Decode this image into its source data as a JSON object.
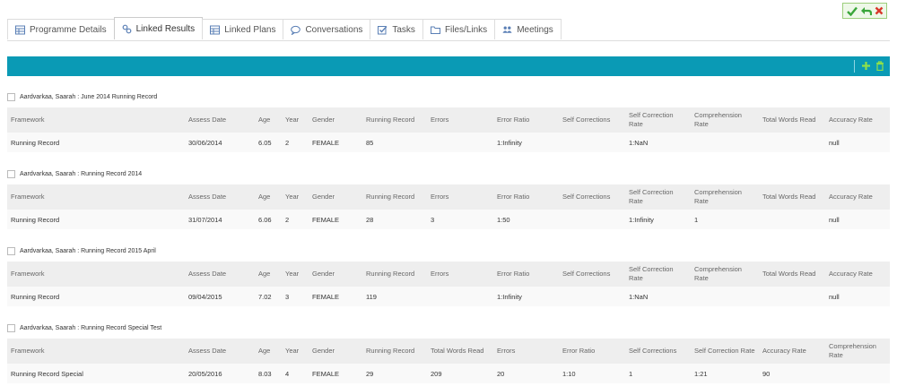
{
  "tabs": [
    {
      "label": "Programme Details",
      "icon": "table-icon",
      "active": false
    },
    {
      "label": "Linked Results",
      "icon": "link-icon",
      "active": true
    },
    {
      "label": "Linked Plans",
      "icon": "table-icon",
      "active": false
    },
    {
      "label": "Conversations",
      "icon": "chat-bubble-icon",
      "active": false
    },
    {
      "label": "Tasks",
      "icon": "checkbox-icon",
      "active": false
    },
    {
      "label": "Files/Links",
      "icon": "folder-icon",
      "active": false
    },
    {
      "label": "Meetings",
      "icon": "users-icon",
      "active": false
    }
  ],
  "actions": {
    "save": "check-icon",
    "undo": "undo-icon",
    "close": "close-icon"
  },
  "toolbar": {
    "add": "plus-icon",
    "delete": "trash-icon"
  },
  "colors": {
    "accent": "#0a9ab5",
    "save": "#3aa63a",
    "close": "#d9372b"
  },
  "records": [
    {
      "title": "Aardvarkaa, Saarah : June 2014 Running Record",
      "columns": [
        "Framework",
        "Assess Date",
        "Age",
        "Year",
        "Gender",
        "Running Record",
        "Errors",
        "Error Ratio",
        "Self Corrections",
        "Self Correction Rate",
        "Comprehension Rate",
        "Total Words Read",
        "Accuracy Rate"
      ],
      "rows": [
        [
          "Running Record",
          "30/06/2014",
          "6.05",
          "2",
          "FEMALE",
          "85",
          "",
          "1:Infinity",
          "",
          "1:NaN",
          "",
          "",
          "null"
        ]
      ]
    },
    {
      "title": "Aardvarkaa, Saarah : Running Record 2014",
      "columns": [
        "Framework",
        "Assess Date",
        "Age",
        "Year",
        "Gender",
        "Running Record",
        "Errors",
        "Error Ratio",
        "Self Corrections",
        "Self Correction Rate",
        "Comprehension Rate",
        "Total Words Read",
        "Accuracy Rate"
      ],
      "rows": [
        [
          "Running Record",
          "31/07/2014",
          "6.06",
          "2",
          "FEMALE",
          "28",
          "3",
          "1:50",
          "",
          "1:Infinity",
          "1",
          "",
          "null"
        ]
      ]
    },
    {
      "title": "Aardvarkaa, Saarah : Running Record 2015 April",
      "columns": [
        "Framework",
        "Assess Date",
        "Age",
        "Year",
        "Gender",
        "Running Record",
        "Errors",
        "Error Ratio",
        "Self Corrections",
        "Self Correction Rate",
        "Comprehension Rate",
        "Total Words Read",
        "Accuracy Rate"
      ],
      "rows": [
        [
          "Running Record",
          "09/04/2015",
          "7.02",
          "3",
          "FEMALE",
          "119",
          "",
          "1:Infinity",
          "",
          "1:NaN",
          "",
          "",
          "null"
        ]
      ]
    },
    {
      "title": "Aardvarkaa, Saarah : Running Record Special Test",
      "columns": [
        "Framework",
        "Assess Date",
        "Age",
        "Year",
        "Gender",
        "Running Record",
        "Total Words Read",
        "Errors",
        "Error Ratio",
        "Self Corrections",
        "Self Correction Rate",
        "Accuracy Rate",
        "Comprehension Rate"
      ],
      "rows": [
        [
          "Running Record Special",
          "20/05/2016",
          "8.03",
          "4",
          "FEMALE",
          "29",
          "209",
          "20",
          "1:10",
          "1",
          "1:21",
          "90",
          ""
        ]
      ]
    }
  ]
}
